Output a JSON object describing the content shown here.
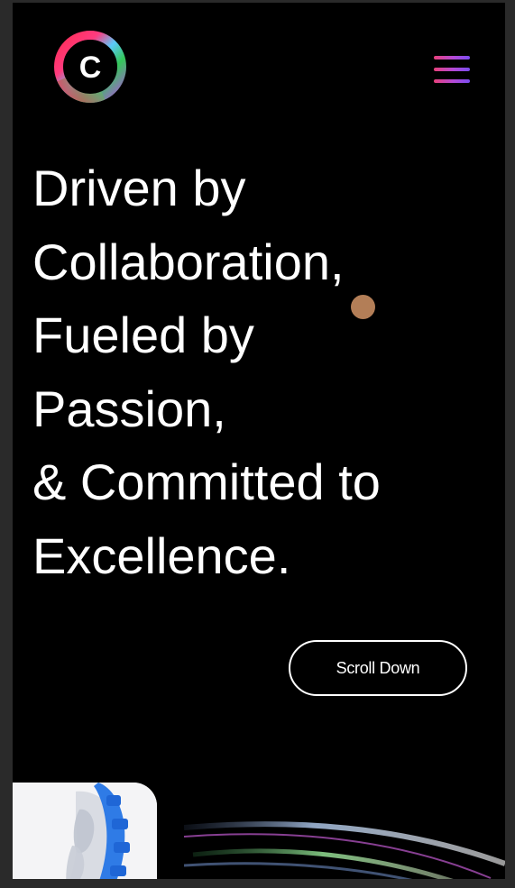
{
  "header": {
    "logo_letter": "C",
    "logo_icon": "brand-ring-logo-icon",
    "menu_icon": "hamburger-menu-icon"
  },
  "hero": {
    "headline_lines": [
      "Driven by",
      "Collaboration,",
      "Fueled by",
      "Passion,",
      "& Committed to",
      "Excellence."
    ],
    "scroll_label": "Scroll Down"
  },
  "colors": {
    "background": "#000000",
    "text": "#ffffff",
    "cursor_dot": "#b37e57",
    "menu_gradient": [
      "#e8407a",
      "#b34ad8",
      "#7a4cf0"
    ],
    "logo_ring": [
      "#ff2d55",
      "#ff9500",
      "#34c759",
      "#5ac8fa",
      "#5856d6",
      "#af52de"
    ]
  }
}
